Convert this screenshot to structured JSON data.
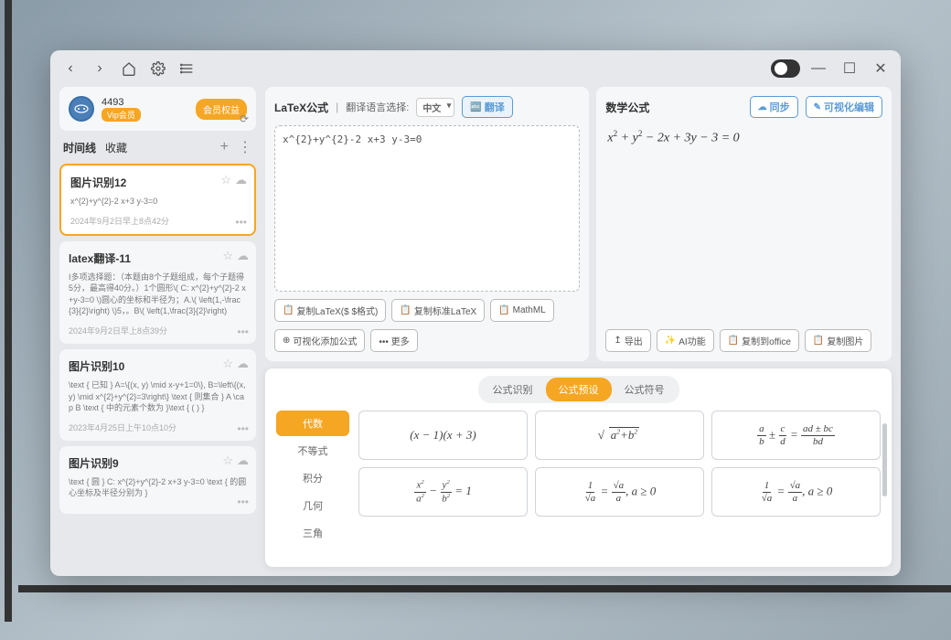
{
  "profile": {
    "username": "4493",
    "vip_label": "Vip会员",
    "member_btn": "会员权益"
  },
  "timeline": {
    "tab_timeline": "时间线",
    "tab_favorites": "收藏"
  },
  "history": [
    {
      "title": "图片识别12",
      "content": "x^{2}+y^{2}-2 x+3 y-3=0",
      "time": "2024年9月2日早上8点42分",
      "selected": true
    },
    {
      "title": "latex翻译-11",
      "content": "I多项选择题：（本题由8个子题组成，每个子题得5分，最高得40分。）1个圆形\\( C: x^{2}+y^{2}-2 x+y-3=0 \\)圆心的坐标和半径为；A.\\( \\left(1,-\\frac{3}{2}\\right) \\)5，。B\\( \\left(1,\\frac{3}{2}\\right)",
      "time": "2024年9月2日早上8点39分",
      "selected": false
    },
    {
      "title": "图片识别10",
      "content": "\\text { 已知 } A=\\{(x, y) \\mid x-y+1=0\\}, B=\\left\\{(x, y) \\mid x^{2}+y^{2}=3\\right\\} \\text { 则集合 } A \\cap B \\text { 中的元素个数为 }\\text { ( ) }",
      "time": "2023年4月25日上午10点10分",
      "selected": false
    },
    {
      "title": "图片识别9",
      "content": "\\text { 圆 } C: x^{2}+y^{2}-2 x+3 y-3=0 \\text { 的圆心坐标及半径分别为 }",
      "time": "",
      "selected": false
    }
  ],
  "latex_panel": {
    "title": "LaTeX公式",
    "lang_label": "翻译语言选择:",
    "lang_value": "中文",
    "translate_btn": "翻译",
    "textarea_value": "x^{2}+y^{2}-2 x+3 y-3=0",
    "buttons": {
      "copy_dollar": "复制LaTeX($ $格式)",
      "copy_std": "复制标准LaTeX",
      "mathml": "MathML",
      "vis_add": "可视化添加公式",
      "more": "••• 更多"
    }
  },
  "math_panel": {
    "title": "数学公式",
    "sync_btn": "同步",
    "vis_edit_btn": "可视化编辑",
    "preview": "x² + y² − 2x + 3y − 3 = 0",
    "buttons": {
      "export": "导出",
      "ai": "AI功能",
      "copy_office": "复制到office",
      "copy_image": "复制图片"
    }
  },
  "tabs": {
    "recognition": "公式识别",
    "preset": "公式预设",
    "symbols": "公式符号"
  },
  "categories": [
    "代数",
    "不等式",
    "积分",
    "几何",
    "三角"
  ],
  "presets": [
    {
      "latex": "(x-1)(x+3)"
    },
    {
      "latex": "\\sqrt{a^2+b^2}"
    },
    {
      "latex": "\\frac{a}{b}\\pm\\frac{c}{d}=\\frac{ad\\pm bc}{bd}"
    },
    {
      "latex": "\\frac{x^2}{a^2}-\\frac{y^2}{b^2}=1"
    },
    {
      "latex": "\\frac{1}{\\sqrt{a}}=\\frac{\\sqrt{a}}{a}, a\\ge 0"
    },
    {
      "latex": "\\frac{1}{\\sqrt{a}}=\\frac{\\sqrt{a}}{a}, a\\ge 0"
    }
  ]
}
